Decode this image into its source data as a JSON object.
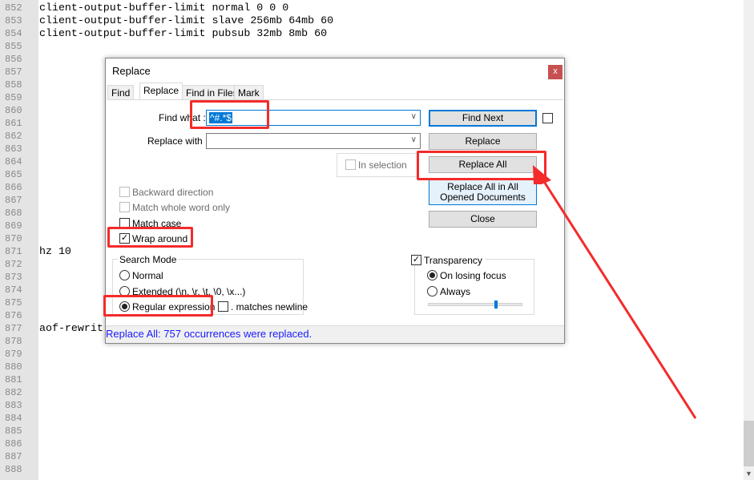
{
  "editor": {
    "lines": [
      {
        "n": "852",
        "text": "client-output-buffer-limit normal 0 0 0"
      },
      {
        "n": "853",
        "text": "client-output-buffer-limit slave 256mb 64mb 60"
      },
      {
        "n": "854",
        "text": "client-output-buffer-limit pubsub 32mb 8mb 60"
      },
      {
        "n": "855",
        "text": ""
      },
      {
        "n": "856",
        "text": ""
      },
      {
        "n": "857",
        "text": ""
      },
      {
        "n": "858",
        "text": ""
      },
      {
        "n": "859",
        "text": ""
      },
      {
        "n": "860",
        "text": ""
      },
      {
        "n": "861",
        "text": ""
      },
      {
        "n": "862",
        "text": ""
      },
      {
        "n": "863",
        "text": ""
      },
      {
        "n": "864",
        "text": ""
      },
      {
        "n": "865",
        "text": ""
      },
      {
        "n": "866",
        "text": ""
      },
      {
        "n": "867",
        "text": ""
      },
      {
        "n": "868",
        "text": ""
      },
      {
        "n": "869",
        "text": ""
      },
      {
        "n": "870",
        "text": ""
      },
      {
        "n": "871",
        "text": "hz 10"
      },
      {
        "n": "872",
        "text": ""
      },
      {
        "n": "873",
        "text": ""
      },
      {
        "n": "874",
        "text": ""
      },
      {
        "n": "875",
        "text": ""
      },
      {
        "n": "876",
        "text": ""
      },
      {
        "n": "877",
        "text": "aof-rewrit"
      },
      {
        "n": "878",
        "text": ""
      },
      {
        "n": "879",
        "text": ""
      },
      {
        "n": "880",
        "text": ""
      },
      {
        "n": "881",
        "text": ""
      },
      {
        "n": "882",
        "text": ""
      },
      {
        "n": "883",
        "text": ""
      },
      {
        "n": "884",
        "text": ""
      },
      {
        "n": "885",
        "text": ""
      },
      {
        "n": "886",
        "text": ""
      },
      {
        "n": "887",
        "text": ""
      },
      {
        "n": "888",
        "text": ""
      }
    ]
  },
  "dialog": {
    "title": "Replace",
    "close": "x",
    "tabs": [
      "Find",
      "Replace",
      "Find in Files",
      "Mark"
    ],
    "active_tab": "Replace",
    "find_what_label": "Find what :",
    "find_what_value": "^#.*$",
    "replace_with_label": "Replace with :",
    "replace_with_value": "",
    "in_selection": "In selection",
    "buttons": {
      "find_next": "Find Next",
      "replace": "Replace",
      "replace_all": "Replace All",
      "replace_all_opened": "Replace All in All Opened Documents",
      "close": "Close"
    },
    "options": {
      "backward": "Backward direction",
      "whole_word": "Match whole word only",
      "match_case": "Match case",
      "wrap_around": "Wrap around"
    },
    "search_mode": {
      "title": "Search Mode",
      "normal": "Normal",
      "extended": "Extended (\\n, \\r, \\t, \\0, \\x...)",
      "regex": "Regular expression",
      "dot_newline": ". matches newline",
      "selected": "regex"
    },
    "transparency": {
      "label": "Transparency",
      "checked": true,
      "on_losing_focus": "On losing focus",
      "always": "Always",
      "selected": "on_losing_focus",
      "slider_percent": 72
    },
    "status": "Replace All: 757 occurrences were replaced."
  },
  "colors": {
    "annotation": "#f42b2b",
    "status_text": "#1a1aff",
    "accent": "#0078d7"
  }
}
